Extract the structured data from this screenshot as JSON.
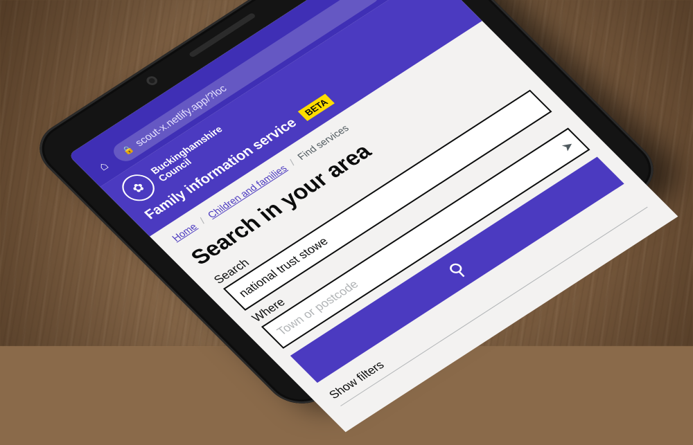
{
  "browser": {
    "url": "scout-x.netlify.app/?loc",
    "home_icon": "home-icon",
    "lock_icon": "lock-icon",
    "tabs_count": "1",
    "menu_icon": "kebab-menu-icon"
  },
  "site": {
    "council_name": "Buckinghamshire Council",
    "service_name": "Family information service",
    "beta_label": "BETA",
    "brand_color": "#4b3ac0",
    "beta_color": "#ffdd00"
  },
  "breadcrumb": {
    "items": [
      "Home",
      "Children and families",
      "Find services"
    ]
  },
  "page": {
    "title": "Search in your area",
    "search_label": "Search",
    "search_value": "national trust stowe",
    "where_label": "Where",
    "where_placeholder": "Town or postcode",
    "search_button_icon": "search-icon",
    "filters_label": "Show filters"
  }
}
